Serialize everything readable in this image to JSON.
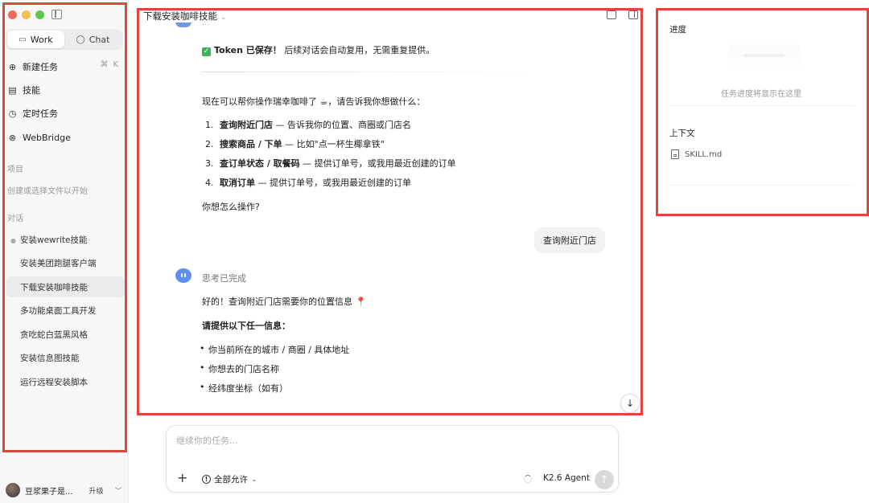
{
  "window": {
    "title": "下载安装咖啡技能"
  },
  "sidebar": {
    "traffic_lights": [
      "#ed6a5e",
      "#f5bf4f",
      "#61c554"
    ],
    "modes": [
      {
        "label": "Work",
        "icon": "monitor-icon",
        "active": true
      },
      {
        "label": "Chat",
        "icon": "chat-bubble-icon",
        "active": false
      }
    ],
    "nav": [
      {
        "label": "新建任务",
        "icon": "plus-circle-icon",
        "shortcut": "⌘K"
      },
      {
        "label": "技能",
        "icon": "skill-book-icon"
      },
      {
        "label": "定时任务",
        "icon": "alarm-clock-icon"
      },
      {
        "label": "WebBridge",
        "icon": "web-bridge-icon"
      }
    ],
    "projects_label": "项目",
    "projects_hint": "创建或选择文件以开始",
    "conversations_label": "对话",
    "conversations": [
      "安装wewrite技能",
      "安装美团跑腿客户端",
      "下载安装咖啡技能",
      "多功能桌面工具开发",
      "贪吃蛇白蓝黑风格",
      "安装信息图技能",
      "运行远程安装脚本"
    ],
    "active_conversation": 2,
    "user": {
      "name": "豆浆果子是...",
      "upgrade_label": "升级"
    }
  },
  "chat": {
    "token_saved_bold": "Token 已保存！",
    "token_saved_rest": "后续对话会自动复用，无需重复提供。",
    "intro": "现在可以帮你操作瑞幸咖啡了 ☕，请告诉我你想做什么：",
    "options": [
      {
        "num": "1.",
        "bold": "查询附近门店",
        "rest": " — 告诉我你的位置、商圈或门店名"
      },
      {
        "num": "2.",
        "bold": "搜索商品 / 下单",
        "rest": " — 比如\"点一杯生椰拿铁\""
      },
      {
        "num": "3.",
        "bold": "查订单状态 / 取餐码",
        "rest": " — 提供订单号，或我用最近创建的订单"
      },
      {
        "num": "4.",
        "bold": "取消订单",
        "rest": " — 提供订单号，或我用最近创建的订单"
      }
    ],
    "ask": "你想怎么操作?",
    "user_message": "查询附近门店",
    "thinking_status": "思考已完成",
    "reply_intro": "好的！查询附近门店需要你的位置信息 📍",
    "reply_heading": "请提供以下任一信息：",
    "reply_items": [
      "你当前所在的城市 / 商圈 / 具体地址",
      "你想去的门店名称",
      "经纬度坐标（如有）"
    ]
  },
  "composer": {
    "placeholder": "继续你的任务...",
    "permission_label": "全部允许",
    "model_label": "K2.6 Agent"
  },
  "right_panel": {
    "progress_title": "进度",
    "progress_empty": "任务进度将显示在这里",
    "context_title": "上下文",
    "context_files": [
      "SKILL.md"
    ]
  },
  "colors": {
    "highlight_border": "#e2463a",
    "accent_blue": "#5e8ff0",
    "check_green": "#3cb35a"
  }
}
